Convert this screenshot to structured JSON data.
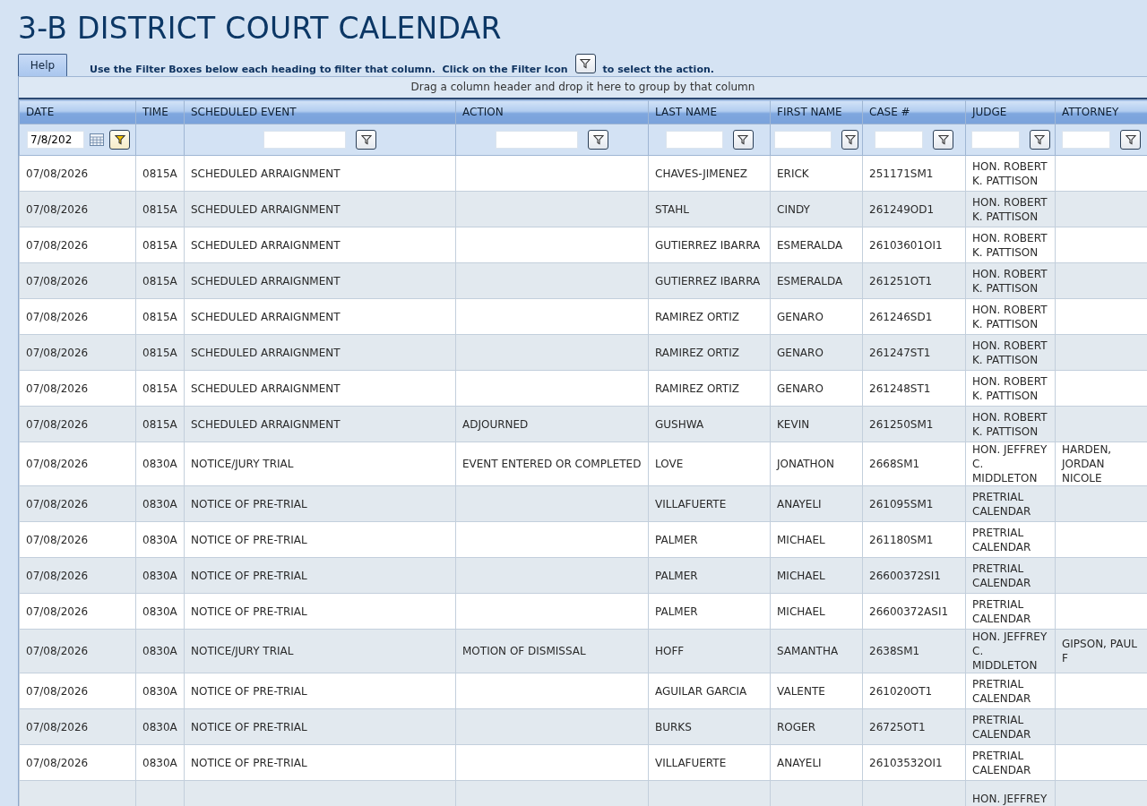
{
  "title": "3-B DISTRICT COURT CALENDAR",
  "help_tab": {
    "label": "Help"
  },
  "instructions": {
    "before": "Use the Filter Boxes below each heading to filter that column.  Click on the Filter Icon",
    "after": "to select the action."
  },
  "group_hint": "Drag a column header and drop it here to group by that column",
  "columns": [
    {
      "label": "DATE",
      "kind": "date",
      "value": "7/8/202",
      "active": true
    },
    {
      "label": "TIME",
      "kind": "plain"
    },
    {
      "label": "SCHEDULED EVENT",
      "kind": "text",
      "active": false
    },
    {
      "label": "ACTION",
      "kind": "text",
      "active": false
    },
    {
      "label": "LAST NAME",
      "kind": "text",
      "active": false
    },
    {
      "label": "FIRST NAME",
      "kind": "text",
      "active": false
    },
    {
      "label": "CASE #",
      "kind": "text",
      "active": false
    },
    {
      "label": "JUDGE",
      "kind": "text",
      "active": false
    },
    {
      "label": "ATTORNEY",
      "kind": "text",
      "active": false
    }
  ],
  "rows": [
    {
      "date": "07/08/2026",
      "time": "0815A",
      "event": "SCHEDULED ARRAIGNMENT",
      "last": "CHAVES-JIMENEZ",
      "first": "ERICK",
      "case": "251171SM1",
      "judge": "HON. ROBERT K. PATTISON"
    },
    {
      "date": "07/08/2026",
      "time": "0815A",
      "event": "SCHEDULED ARRAIGNMENT",
      "last": "STAHL",
      "first": "CINDY",
      "case": "261249OD1",
      "judge": "HON. ROBERT K. PATTISON"
    },
    {
      "date": "07/08/2026",
      "time": "0815A",
      "event": "SCHEDULED ARRAIGNMENT",
      "last": "GUTIERREZ IBARRA",
      "first": "ESMERALDA",
      "case": "26103601OI1",
      "judge": "HON. ROBERT K. PATTISON"
    },
    {
      "date": "07/08/2026",
      "time": "0815A",
      "event": "SCHEDULED ARRAIGNMENT",
      "last": "GUTIERREZ IBARRA",
      "first": "ESMERALDA",
      "case": "261251OT1",
      "judge": "HON. ROBERT K. PATTISON"
    },
    {
      "date": "07/08/2026",
      "time": "0815A",
      "event": "SCHEDULED ARRAIGNMENT",
      "last": "RAMIREZ ORTIZ",
      "first": "GENARO",
      "case": "261246SD1",
      "judge": "HON. ROBERT K. PATTISON"
    },
    {
      "date": "07/08/2026",
      "time": "0815A",
      "event": "SCHEDULED ARRAIGNMENT",
      "last": "RAMIREZ ORTIZ",
      "first": "GENARO",
      "case": "261247ST1",
      "judge": "HON. ROBERT K. PATTISON"
    },
    {
      "date": "07/08/2026",
      "time": "0815A",
      "event": "SCHEDULED ARRAIGNMENT",
      "last": "RAMIREZ ORTIZ",
      "first": "GENARO",
      "case": "261248ST1",
      "judge": "HON. ROBERT K. PATTISON"
    },
    {
      "date": "07/08/2026",
      "time": "0815A",
      "event": "SCHEDULED ARRAIGNMENT",
      "action": "ADJOURNED",
      "last": "GUSHWA",
      "first": "KEVIN",
      "case": "261250SM1",
      "judge": "HON. ROBERT K. PATTISON"
    },
    {
      "date": "07/08/2026",
      "time": "0830A",
      "event": "NOTICE/JURY TRIAL",
      "action": "EVENT ENTERED OR COMPLETED",
      "last": "LOVE",
      "first": "JONATHON",
      "case": "2668SM1",
      "judge": "HON. JEFFREY C. MIDDLETON",
      "attorney": "HARDEN, JORDAN NICOLE"
    },
    {
      "date": "07/08/2026",
      "time": "0830A",
      "event": "NOTICE OF PRE-TRIAL",
      "last": "VILLAFUERTE",
      "first": "ANAYELI",
      "case": "261095SM1",
      "judge": "PRETRIAL CALENDAR"
    },
    {
      "date": "07/08/2026",
      "time": "0830A",
      "event": "NOTICE OF PRE-TRIAL",
      "last": "PALMER",
      "first": "MICHAEL",
      "case": "261180SM1",
      "judge": "PRETRIAL CALENDAR"
    },
    {
      "date": "07/08/2026",
      "time": "0830A",
      "event": "NOTICE OF PRE-TRIAL",
      "last": "PALMER",
      "first": "MICHAEL",
      "case": "26600372SI1",
      "judge": "PRETRIAL CALENDAR"
    },
    {
      "date": "07/08/2026",
      "time": "0830A",
      "event": "NOTICE OF PRE-TRIAL",
      "last": "PALMER",
      "first": "MICHAEL",
      "case": "26600372ASI1",
      "judge": "PRETRIAL CALENDAR"
    },
    {
      "date": "07/08/2026",
      "time": "0830A",
      "event": "NOTICE/JURY TRIAL",
      "action": "MOTION OF DISMISSAL",
      "last": "HOFF",
      "first": "SAMANTHA",
      "case": "2638SM1",
      "judge": "HON. JEFFREY C. MIDDLETON",
      "attorney": "GIPSON, PAUL F"
    },
    {
      "date": "07/08/2026",
      "time": "0830A",
      "event": "NOTICE OF PRE-TRIAL",
      "last": "AGUILAR GARCIA",
      "first": "VALENTE",
      "case": "261020OT1",
      "judge": "PRETRIAL CALENDAR"
    },
    {
      "date": "07/08/2026",
      "time": "0830A",
      "event": "NOTICE OF PRE-TRIAL",
      "last": "BURKS",
      "first": "ROGER",
      "case": "26725OT1",
      "judge": "PRETRIAL CALENDAR"
    },
    {
      "date": "07/08/2026",
      "time": "0830A",
      "event": "NOTICE OF PRE-TRIAL",
      "last": "VILLAFUERTE",
      "first": "ANAYELI",
      "case": "26103532OI1",
      "judge": "PRETRIAL CALENDAR"
    },
    {
      "judge": "HON. JEFFREY"
    }
  ]
}
